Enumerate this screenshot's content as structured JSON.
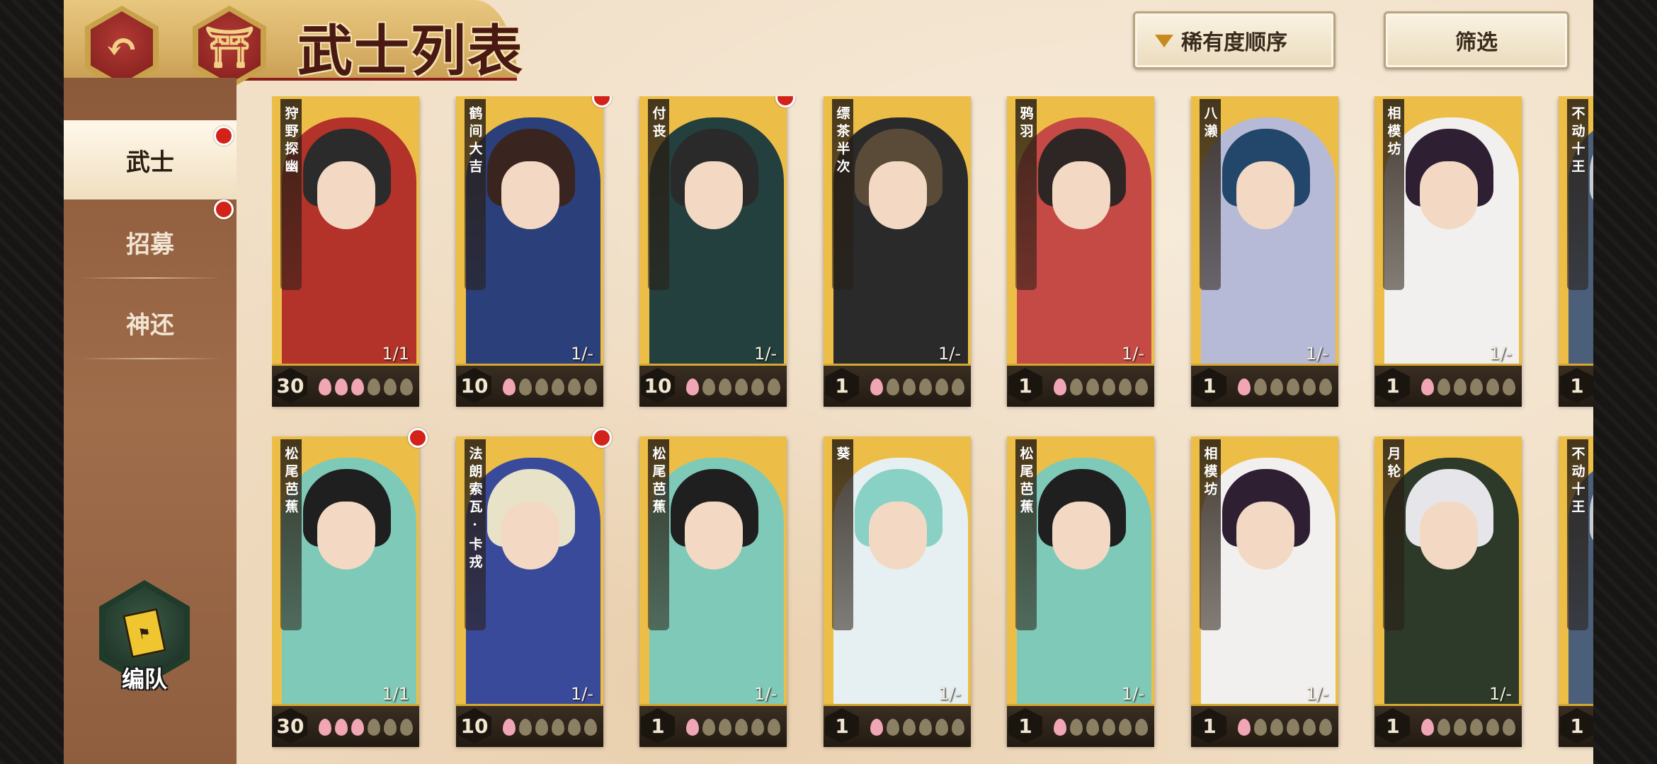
{
  "header": {
    "back_icon": "undo-arrow-icon",
    "home_icon": "castle-home-icon",
    "title": "武士列表",
    "sort_label": "稀有度顺序",
    "filter_label": "筛选"
  },
  "sidebar": {
    "tabs": [
      {
        "label": "武士",
        "active": true,
        "badge": true
      },
      {
        "label": "招募",
        "active": false,
        "badge": true
      },
      {
        "label": "神还",
        "active": false,
        "badge": false
      }
    ],
    "team_button_label": "编队"
  },
  "cards": [
    {
      "name": "狩野探幽",
      "level": "30",
      "count": "1/1",
      "petals": 3,
      "badge": false,
      "palette": [
        "#2b2b2b",
        "#b3322a"
      ]
    },
    {
      "name": "鹤间大吉",
      "level": "10",
      "count": "1/-",
      "petals": 1,
      "badge": true,
      "palette": [
        "#3a2420",
        "#2b3f7a"
      ]
    },
    {
      "name": "付丧",
      "level": "10",
      "count": "1/-",
      "petals": 1,
      "badge": true,
      "palette": [
        "#2a2a2a",
        "#233f3e"
      ]
    },
    {
      "name": "缥茶半次",
      "level": "1",
      "count": "1/-",
      "petals": 1,
      "badge": false,
      "palette": [
        "#5a4a38",
        "#2a2a2a"
      ]
    },
    {
      "name": "鸦羽",
      "level": "1",
      "count": "1/-",
      "petals": 1,
      "badge": false,
      "palette": [
        "#2d2624",
        "#c54a45"
      ]
    },
    {
      "name": "八濑",
      "level": "1",
      "count": "1/-",
      "petals": 1,
      "badge": false,
      "palette": [
        "#23476b",
        "#b7bad6"
      ]
    },
    {
      "name": "相模坊",
      "level": "1",
      "count": "1/-",
      "petals": 1,
      "badge": false,
      "palette": [
        "#2e1f33",
        "#f2f0ee"
      ]
    },
    {
      "name": "不动十王",
      "level": "1",
      "count": "",
      "petals": 0,
      "badge": false,
      "palette": [
        "#c5cbd2",
        "#4b5f7a"
      ]
    },
    {
      "name": "松尾芭蕉",
      "level": "30",
      "count": "1/1",
      "petals": 3,
      "badge": true,
      "palette": [
        "#1f1f1f",
        "#7fc9b8"
      ]
    },
    {
      "name": "法朗索瓦·卡戎",
      "level": "10",
      "count": "1/-",
      "petals": 1,
      "badge": true,
      "palette": [
        "#e8e2c8",
        "#3a4a9a"
      ]
    },
    {
      "name": "松尾芭蕉",
      "level": "1",
      "count": "1/-",
      "petals": 1,
      "badge": false,
      "palette": [
        "#1f1f1f",
        "#7fc9b8"
      ]
    },
    {
      "name": "葵",
      "level": "1",
      "count": "1/-",
      "petals": 1,
      "badge": false,
      "palette": [
        "#88d1c4",
        "#e6f0f2"
      ]
    },
    {
      "name": "松尾芭蕉",
      "level": "1",
      "count": "1/-",
      "petals": 1,
      "badge": false,
      "palette": [
        "#1f1f1f",
        "#7fc9b8"
      ]
    },
    {
      "name": "相模坊",
      "level": "1",
      "count": "1/-",
      "petals": 1,
      "badge": false,
      "palette": [
        "#2e1f33",
        "#f2f0ee"
      ]
    },
    {
      "name": "月轮",
      "level": "1",
      "count": "1/-",
      "petals": 1,
      "badge": false,
      "palette": [
        "#e6e6ea",
        "#2d3a2a"
      ]
    },
    {
      "name": "不动十王",
      "level": "1",
      "count": "",
      "petals": 0,
      "badge": false,
      "palette": [
        "#c5cbd2",
        "#4b5f7a"
      ]
    }
  ],
  "colors": {
    "accent_red": "#d2221a",
    "gold": "#ecbe48",
    "sidebar_brown": "#8b5a3a"
  }
}
